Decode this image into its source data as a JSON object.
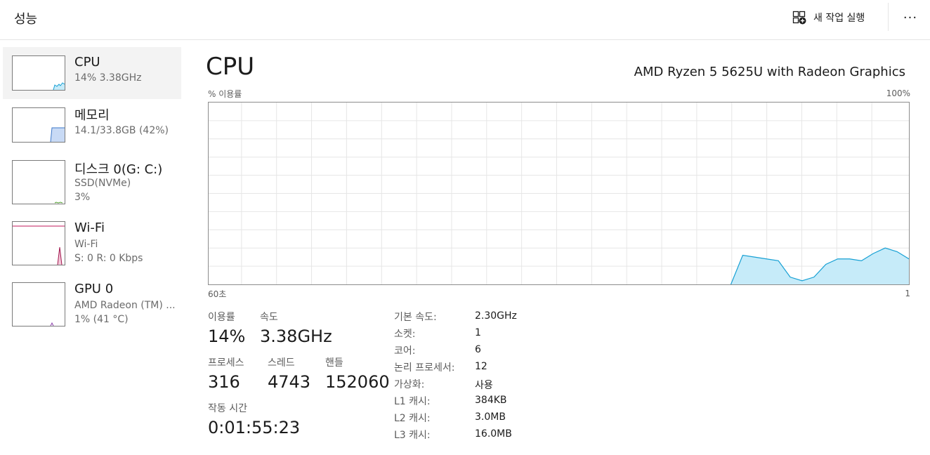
{
  "header": {
    "title": "성능",
    "run_task_label": "새 작업 실행",
    "more_label": "···"
  },
  "sidebar": {
    "items": [
      {
        "name": "CPU",
        "line1": "14%  3.38GHz",
        "line2": ""
      },
      {
        "name": "메모리",
        "line1": "14.1/33.8GB (42%)",
        "line2": ""
      },
      {
        "name": "디스크 0(G: C:)",
        "line1": "SSD(NVMe)",
        "line2": "3%"
      },
      {
        "name": "Wi-Fi",
        "line1": "Wi-Fi",
        "line2": "S: 0  R: 0 Kbps"
      },
      {
        "name": "GPU 0",
        "line1": "AMD Radeon (TM) ...",
        "line2": "1% (41 °C)"
      }
    ]
  },
  "main": {
    "title": "CPU",
    "model": "AMD Ryzen 5 5625U with Radeon Graphics",
    "graph": {
      "ylabel": "% 이용률",
      "ymax_label": "100%",
      "xlabel_left": "60초",
      "xlabel_right": "1"
    },
    "stats": {
      "utilization_label": "이용률",
      "utilization": "14%",
      "speed_label": "속도",
      "speed": "3.38GHz",
      "processes_label": "프로세스",
      "processes": "316",
      "threads_label": "스레드",
      "threads": "4743",
      "handles_label": "핸들",
      "handles": "152060",
      "uptime_label": "작동 시간",
      "uptime": "0:01:55:23"
    },
    "specs": [
      {
        "label": "기본 속도:",
        "value": "2.30GHz"
      },
      {
        "label": "소켓:",
        "value": "1"
      },
      {
        "label": "코어:",
        "value": "6"
      },
      {
        "label": "논리 프로세서:",
        "value": "12"
      },
      {
        "label": "가상화:",
        "value": "사용"
      },
      {
        "label": "L1 캐시:",
        "value": "384KB"
      },
      {
        "label": "L2 캐시:",
        "value": "3.0MB"
      },
      {
        "label": "L3 캐시:",
        "value": "16.0MB"
      }
    ]
  },
  "chart_data": {
    "type": "area",
    "ylabel": "% 이용률",
    "ylim": [
      0,
      100
    ],
    "xlim": [
      60,
      1
    ],
    "x": [
      16,
      15,
      14,
      13,
      12,
      11,
      10,
      9,
      8,
      7,
      6,
      5,
      4,
      3,
      2,
      1
    ],
    "values": [
      0,
      16,
      15,
      14,
      13,
      4,
      2,
      4,
      11,
      14,
      14,
      13,
      17,
      20,
      18,
      14
    ],
    "grid": true,
    "colors": {
      "fill": "#c6ebf9",
      "line": "#17a0d4",
      "grid": "#e6e6e6"
    }
  }
}
